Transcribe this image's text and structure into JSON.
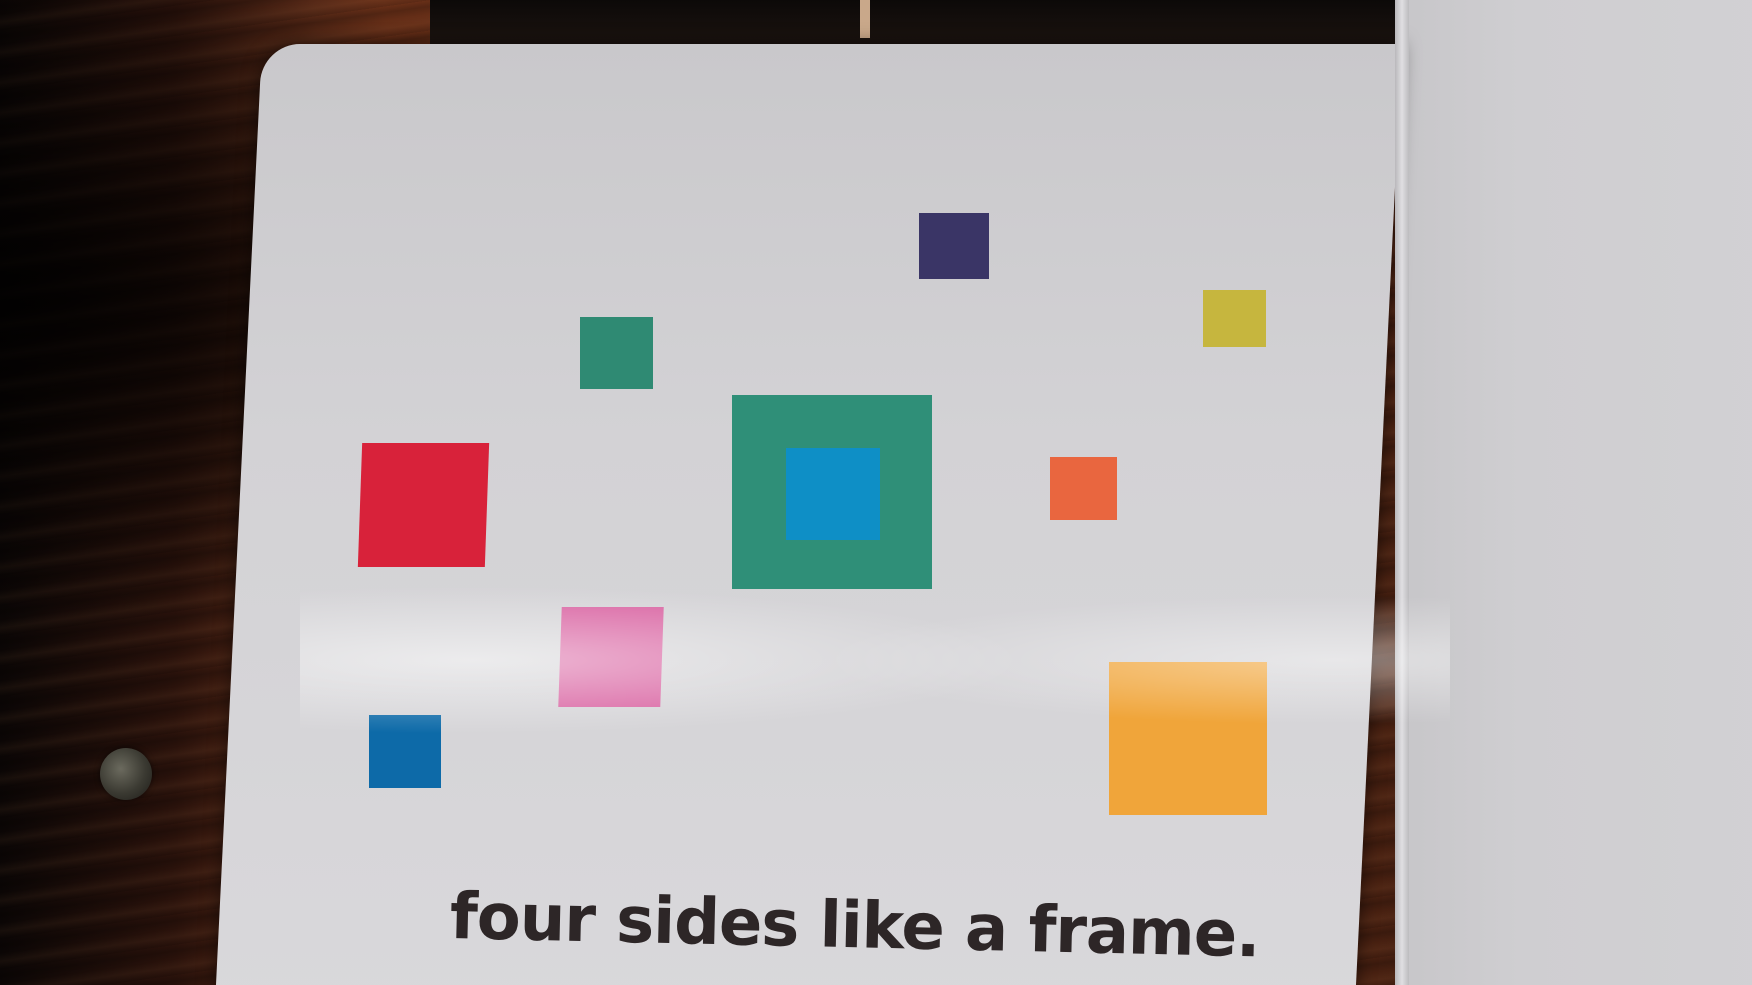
{
  "scene": {
    "description_kind": "photo of an open board book page on a wooden table",
    "caption": "four sides like a frame."
  },
  "colors": {
    "page": "#d2d1d4",
    "navy": "#3a3566",
    "yellow": "#c6b63e",
    "teal": "#2f8a73",
    "red": "#d8223a",
    "frame_teal": "#2f8f78",
    "frame_inner_blue": "#0e8fc6",
    "orange": "#e9663f",
    "pink": "#d964a2",
    "blue": "#0d6aa8",
    "amber": "#f0a53a",
    "text": "#2d2627"
  },
  "shapes": [
    {
      "id": "navy-square",
      "color_key": "navy"
    },
    {
      "id": "yellow-square",
      "color_key": "yellow"
    },
    {
      "id": "teal-square",
      "color_key": "teal"
    },
    {
      "id": "red-square",
      "color_key": "red"
    },
    {
      "id": "frame-square",
      "color_key": "frame_teal"
    },
    {
      "id": "frame-inner-square",
      "color_key": "frame_inner_blue"
    },
    {
      "id": "orange-square",
      "color_key": "orange"
    },
    {
      "id": "pink-square",
      "color_key": "pink"
    },
    {
      "id": "blue-square",
      "color_key": "blue"
    },
    {
      "id": "amber-square",
      "color_key": "amber"
    }
  ]
}
